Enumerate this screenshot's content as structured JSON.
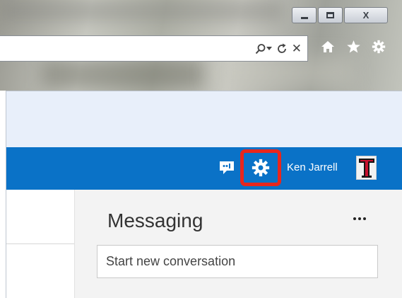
{
  "window": {
    "buttons": {
      "minimize": "minimize",
      "maximize": "maximize",
      "close_label": "X"
    }
  },
  "addressbar": {
    "icons": [
      "search-icon",
      "dropdown-arrow-icon",
      "refresh-icon",
      "stop-icon"
    ],
    "stop_glyph": "✕"
  },
  "toolbar": {
    "icons": [
      "home-icon",
      "favorites-star-icon",
      "settings-gear-icon"
    ]
  },
  "suite_bar": {
    "user_name": "Ken Jarrell",
    "settings_highlight_color": "#e8261c",
    "bar_color": "#0a72c7",
    "icons": [
      "chat-feedback-icon",
      "settings-gear-icon",
      "avatar"
    ]
  },
  "messaging": {
    "title": "Messaging",
    "more_icon": "ellipsis-icon",
    "input_placeholder": "Start new conversation"
  }
}
